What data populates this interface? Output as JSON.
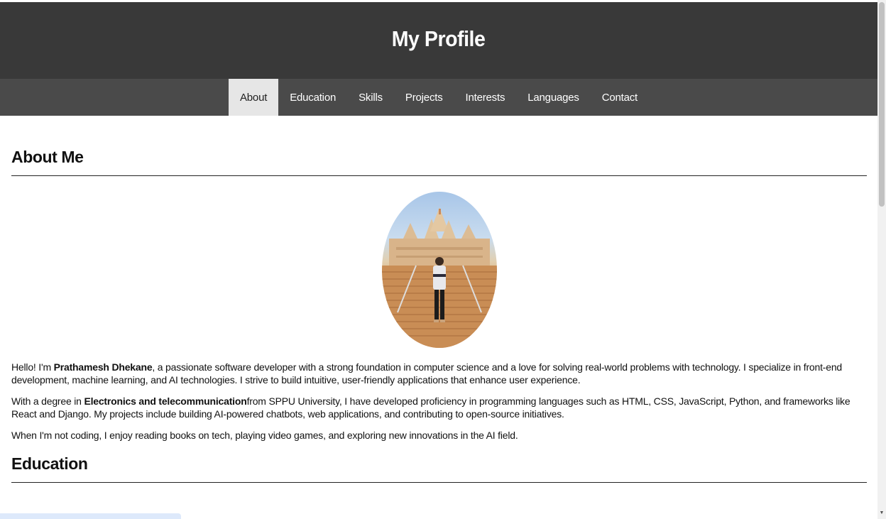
{
  "header": {
    "title": "My Profile"
  },
  "nav": {
    "items": [
      {
        "label": "About",
        "active": true
      },
      {
        "label": "Education",
        "active": false
      },
      {
        "label": "Skills",
        "active": false
      },
      {
        "label": "Projects",
        "active": false
      },
      {
        "label": "Interests",
        "active": false
      },
      {
        "label": "Languages",
        "active": false
      },
      {
        "label": "Contact",
        "active": false
      }
    ]
  },
  "about": {
    "heading": "About Me",
    "photo_icon": "profile-photo",
    "p1": {
      "before": "Hello! I'm ",
      "name": "Prathamesh Dhekane",
      "after": ", a passionate software developer with a strong foundation in computer science and a love for solving real-world problems with technology. I specialize in front-end development, machine learning, and AI technologies. I strive to build intuitive, user-friendly applications that enhance user experience."
    },
    "p2": {
      "before": "With a degree in ",
      "degree": "Electronics and telecommunication",
      "after": "from SPPU University, I have developed proficiency in programming languages such as HTML, CSS, JavaScript, Python, and frameworks like React and Django. My projects include building AI-powered chatbots, web applications, and contributing to open-source initiatives."
    },
    "p3": "When I'm not coding, I enjoy reading books on tech, playing video games, and exploring new innovations in the AI field."
  },
  "education": {
    "heading": "Education"
  },
  "colors": {
    "header_bg": "#393939",
    "nav_bg": "#4a4a4a",
    "nav_active_bg": "#e6e6e6"
  }
}
